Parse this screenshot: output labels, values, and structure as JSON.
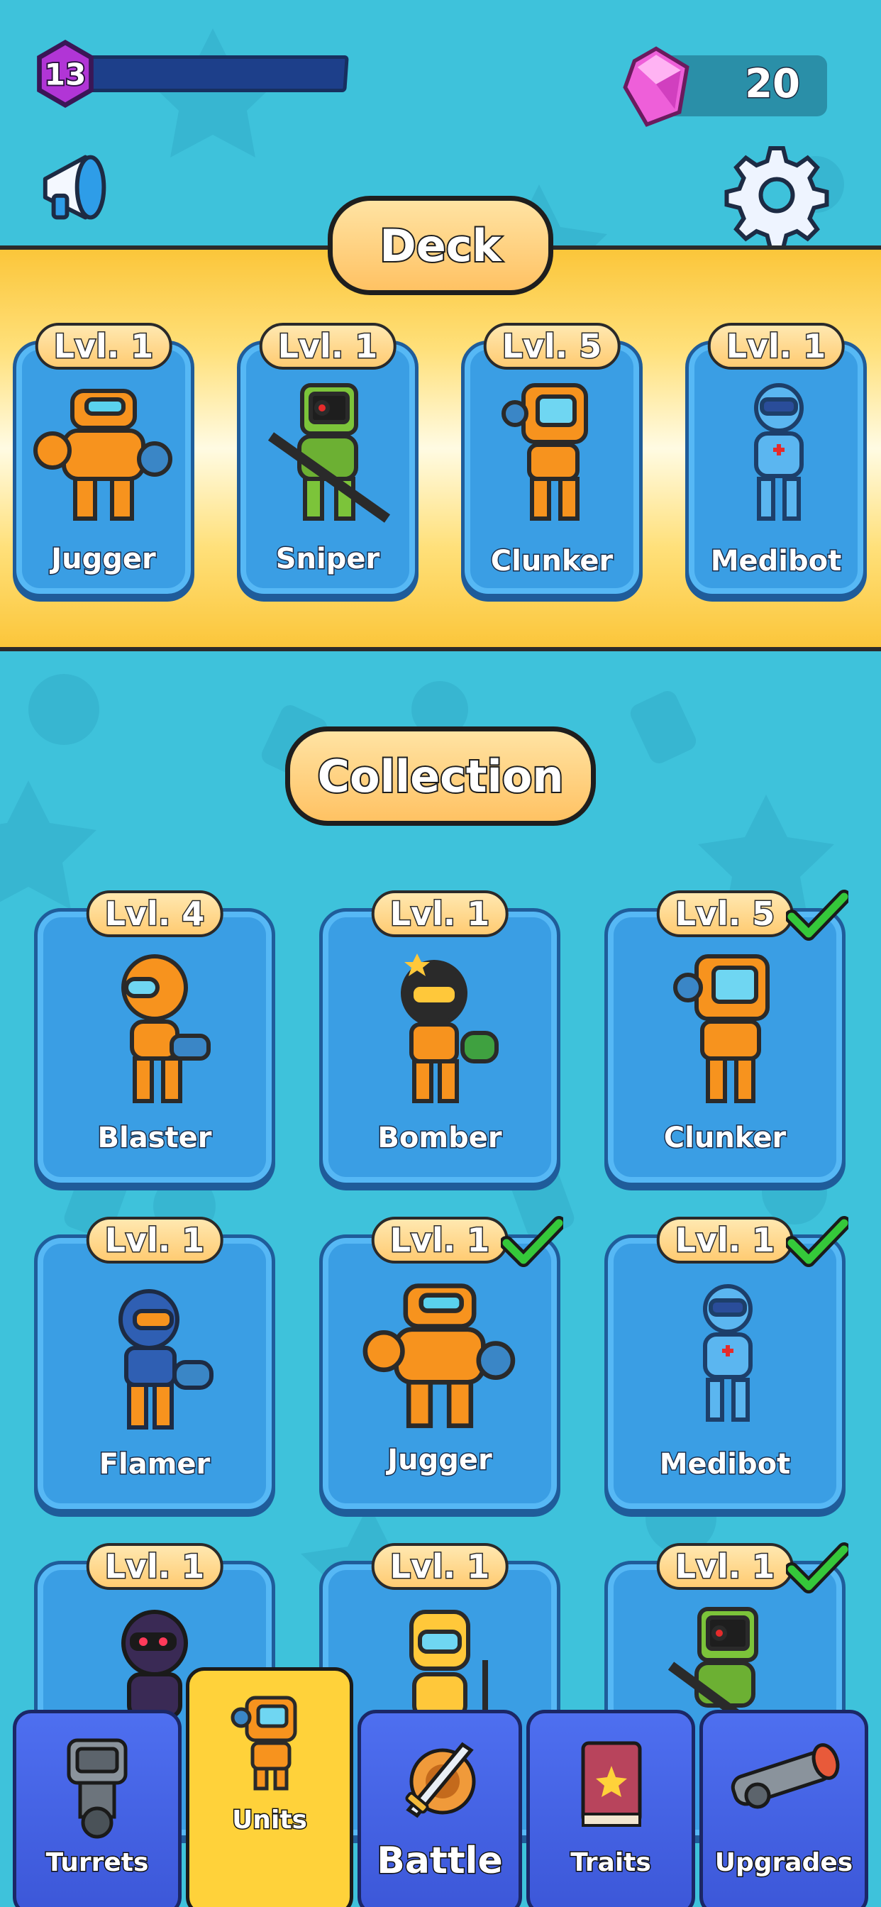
{
  "player": {
    "level": "13",
    "gems": "20"
  },
  "deck": {
    "title": "Deck",
    "cards": [
      {
        "level": "Lvl. 1",
        "name": "Jugger"
      },
      {
        "level": "Lvl. 1",
        "name": "Sniper"
      },
      {
        "level": "Lvl. 5",
        "name": "Clunker"
      },
      {
        "level": "Lvl. 1",
        "name": "Medibot"
      }
    ]
  },
  "collection": {
    "title": "Collection",
    "cards": [
      {
        "level": "Lvl. 4",
        "name": "Blaster",
        "in_deck": false
      },
      {
        "level": "Lvl. 1",
        "name": "Bomber",
        "in_deck": false
      },
      {
        "level": "Lvl. 5",
        "name": "Clunker",
        "in_deck": true
      },
      {
        "level": "Lvl. 1",
        "name": "Flamer",
        "in_deck": false
      },
      {
        "level": "Lvl. 1",
        "name": "Jugger",
        "in_deck": true
      },
      {
        "level": "Lvl. 1",
        "name": "Medibot",
        "in_deck": true
      },
      {
        "level": "Lvl. 1",
        "name": "",
        "in_deck": false
      },
      {
        "level": "Lvl. 1",
        "name": "",
        "in_deck": false
      },
      {
        "level": "Lvl. 1",
        "name": "",
        "in_deck": true
      }
    ]
  },
  "nav": {
    "tabs": [
      {
        "label": "Turrets",
        "icon": "turret-icon"
      },
      {
        "label": "Units",
        "icon": "unit-icon",
        "active": true
      },
      {
        "label": "Battle",
        "icon": "sword-shield-icon"
      },
      {
        "label": "Traits",
        "icon": "book-icon"
      },
      {
        "label": "Upgrades",
        "icon": "cannon-icon"
      }
    ]
  },
  "colors": {
    "background": "#3ec2db",
    "deck_band": "#fbc63a",
    "card": "#3a9ee4",
    "nav_tab": "#4e6ff0",
    "nav_active": "#ffd23a",
    "check": "#35c83a"
  }
}
